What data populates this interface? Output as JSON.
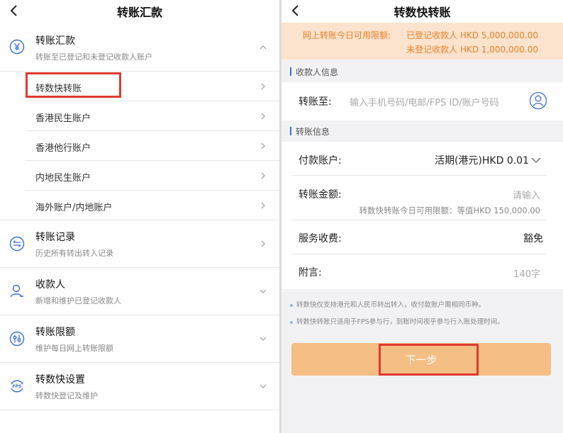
{
  "left": {
    "title": "转账汇款",
    "transfer_section": {
      "title": "转账汇款",
      "subtitle": "转账至已登记和未登记收款人账户",
      "icon": "yen-circle-icon",
      "items": [
        {
          "label": "转数快转账",
          "highlighted": true
        },
        {
          "label": "香港民生账户"
        },
        {
          "label": "香港他行账户"
        },
        {
          "label": "内地民生账户"
        },
        {
          "label": "海外账户/内地账户"
        }
      ]
    },
    "records_section": {
      "title": "转账记录",
      "subtitle": "历史所有转出转入记录",
      "icon": "transfer-arrows-icon"
    },
    "payee_section": {
      "title": "收款人",
      "subtitle": "新增和维护已登记收款人",
      "icon": "person-icon"
    },
    "limit_section": {
      "title": "转账限额",
      "subtitle": "维护每日网上转账限额",
      "icon": "sliders-icon"
    },
    "fps_section": {
      "title": "转数快设置",
      "subtitle": "转数快登记及维护",
      "icon": "fps-icon"
    }
  },
  "right": {
    "title": "转数快转账",
    "limit_banner": {
      "label": "网上转账今日可用限额:",
      "registered": "已登记收款人 HKD 5,000,000.00",
      "unregistered": "未登记收款人 HKD 1,000,000.00"
    },
    "payee_info_header": "收款人信息",
    "to_label": "转账至:",
    "to_placeholder": "输入手机号码/电邮/FPS ID/账户号码",
    "transfer_info_header": "转账信息",
    "pay_account_label": "付款账户:",
    "pay_account_value": "活期(港元)HKD 0.01",
    "amount_label": "转账金额:",
    "amount_placeholder": "请输入",
    "amount_hint": "转数快转账今日可用限额：等值HKD 150,000.00",
    "fee_label": "服务收费:",
    "fee_value": "豁免",
    "remark_label": "附言:",
    "remark_placeholder": "140字",
    "notes": [
      "转数快仅支持港元和人民币转出转入，收付款账户需相同币种。",
      "转数快转账只适用于FPS参与行，到账时间视乎参与行入账处理时间。"
    ],
    "next_button": "下一步"
  },
  "colors": {
    "highlight": "#e03a31",
    "banner_bg": "#fbe3cd",
    "banner_text": "#e8812a",
    "button_bg": "#f4be85",
    "accent_blue": "#3b6fd6"
  }
}
